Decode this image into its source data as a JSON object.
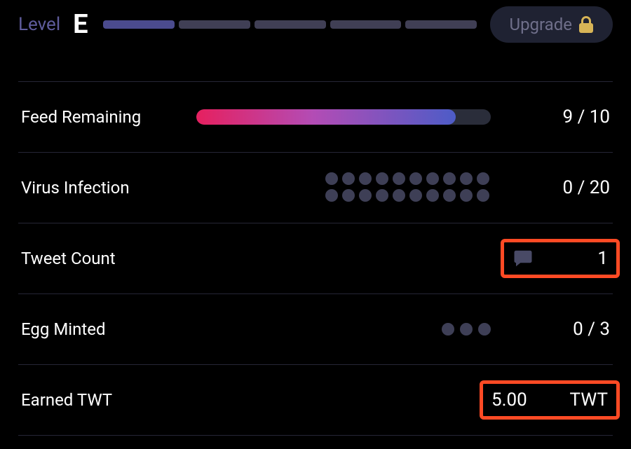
{
  "header": {
    "level_label": "Level",
    "level_value": "E",
    "level_bars_total": 5,
    "level_bars_filled": 1,
    "upgrade_label": "Upgrade"
  },
  "stats": {
    "feed": {
      "label": "Feed Remaining",
      "current": 9,
      "max": 10,
      "pct": 88
    },
    "virus": {
      "label": "Virus Infection",
      "current": 0,
      "max": 20
    },
    "tweet": {
      "label": "Tweet Count",
      "count": 1
    },
    "egg": {
      "label": "Egg Minted",
      "current": 0,
      "max": 3
    },
    "earned": {
      "label": "Earned TWT",
      "amount": "5.00",
      "unit": "TWT"
    }
  }
}
